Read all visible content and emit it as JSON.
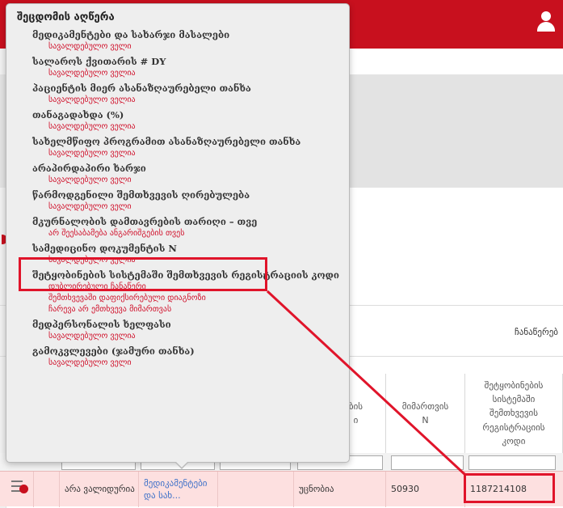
{
  "popover": {
    "title": "შეცდომის აღწერა",
    "items": [
      {
        "name": "მედიკამენტები და სახარჯი მასალები",
        "errors": [
          "სავალდებულო ველი"
        ]
      },
      {
        "name": "სალაროს ქვითარის # DY",
        "errors": [
          "სავალდებულო ველია"
        ]
      },
      {
        "name": "პაციენტის მიერ ასანაზღაურებელი თანხა",
        "errors": [
          "სავალდებულო ველია"
        ]
      },
      {
        "name": "თანაგადახდა (%)",
        "errors": [
          "სავალდებულო ველია"
        ]
      },
      {
        "name": "სახელმწიფო პროგრამით ასანაზღაურებელი თანხა",
        "errors": [
          "სავალდებულო ველია"
        ]
      },
      {
        "name": "არაპირდაპირი ხარჯი",
        "errors": [
          "სავალდებულო ველი"
        ]
      },
      {
        "name": "წარმოდგენილი შემთხვევის ღირებულება",
        "errors": [
          "სავალდებულო ველი"
        ]
      },
      {
        "name": "მკურნალობის დამთავრების თარიღი – თვე",
        "errors": [
          "არ შეესაბამება ანგარიშგების თვეს"
        ]
      },
      {
        "name": "სამედიცინო დოკუმენტის N",
        "errors": [
          "სავალდებულო ველია"
        ]
      },
      {
        "name": "შეტყობინების სისტემაში შემთხვევის რეგისტრაციის კოდი",
        "errors": [
          "დუბლირებული ჩანაწერი",
          "შემთხვევაში დაფიქსირებული დიაგნოზი",
          "ჩარევა არ ემთხვევა მიმართვას"
        ]
      },
      {
        "name": "მედპერსონალის ხელფასი",
        "errors": [
          "სავალდებულო ველია"
        ]
      },
      {
        "name": "გამოკვლევები (ჯამური თანხა)",
        "errors": [
          "სავალდებულო ველი"
        ]
      }
    ]
  },
  "background": {
    "right_label": "ჩანაწერებ"
  },
  "table": {
    "headers": [
      {
        "id": "col-e",
        "label": "ბის\nი"
      },
      {
        "id": "col-f",
        "label": "მიმართვის\nN"
      },
      {
        "id": "col-g",
        "label": "შეტყობინების\nსისტემაში\nშემთხვევის\nრეგისტრაციის\nკოდი"
      }
    ],
    "row": {
      "status": "არა ვალიდურია",
      "medication_link": "მედიკამენტები და სახ...",
      "col_e": "უცნობია",
      "referral_n": "50930",
      "reg_code": "1187214108"
    }
  },
  "colors": {
    "brand_red": "#c8101e",
    "error_red": "#d0112b",
    "highlight": "#e0142a",
    "row_error_bg": "#fde0e0"
  }
}
